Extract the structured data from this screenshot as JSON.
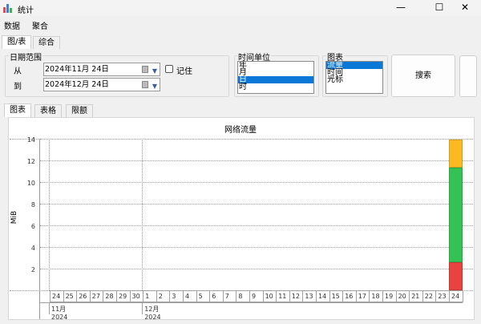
{
  "window": {
    "title": "统计",
    "icon": "bar-chart-app-icon"
  },
  "menu": [
    "数据",
    "聚合"
  ],
  "main_tabs": [
    "图/表",
    "综合"
  ],
  "date_range": {
    "label": "日期范围",
    "from_label": "从",
    "from_value": "2024年11月  24日",
    "to_label": "到",
    "to_value": "2024年12月  24日",
    "remember_label": "记住",
    "remember_checked": false
  },
  "time_unit": {
    "label": "时间单位",
    "options": [
      "年",
      "月",
      "日",
      "时"
    ],
    "selected": "日"
  },
  "chart_type": {
    "label": "图表",
    "options": [
      "流量",
      "时间",
      "光标"
    ],
    "selected": "流量"
  },
  "search_label": "搜索",
  "sub_tabs": [
    "图表",
    "表格",
    "限额"
  ],
  "chart_data": {
    "type": "bar",
    "title": "网络流量",
    "ylabel": "MiB",
    "ylim": [
      0,
      14
    ],
    "yticks": [
      2,
      4,
      6,
      8,
      10,
      12,
      14
    ],
    "grid": true,
    "stacked": true,
    "categories": [
      "24",
      "25",
      "26",
      "27",
      "28",
      "29",
      "30",
      "1",
      "2",
      "3",
      "4",
      "5",
      "6",
      "7",
      "8",
      "9",
      "10",
      "11",
      "12",
      "13",
      "14",
      "15",
      "16",
      "17",
      "18",
      "19",
      "20",
      "21",
      "22",
      "23",
      "24"
    ],
    "month_labels": [
      {
        "label": "11月 2024",
        "start": 0
      },
      {
        "label": "12月 2024",
        "start": 7
      }
    ],
    "series": [
      {
        "color": "#e8433f",
        "values": [
          0,
          0,
          0,
          0,
          0,
          0,
          0,
          0,
          0,
          0,
          0,
          0,
          0,
          0,
          0,
          0,
          0,
          0,
          0,
          0,
          0,
          0,
          0,
          0,
          0,
          0,
          0,
          0,
          0,
          0,
          2.6
        ]
      },
      {
        "color": "#34c254",
        "values": [
          0,
          0,
          0,
          0,
          0,
          0,
          0,
          0,
          0,
          0,
          0,
          0,
          0,
          0,
          0,
          0,
          0,
          0,
          0,
          0,
          0,
          0,
          0,
          0,
          0,
          0,
          0,
          0,
          0,
          0,
          8.7
        ]
      },
      {
        "color": "#fbba22",
        "values": [
          0,
          0,
          0,
          0,
          0,
          0,
          0,
          0,
          0,
          0,
          0,
          0,
          0,
          0,
          0,
          0,
          0,
          0,
          0,
          0,
          0,
          0,
          0,
          0,
          0,
          0,
          0,
          0,
          0,
          0,
          2.6
        ]
      }
    ]
  }
}
